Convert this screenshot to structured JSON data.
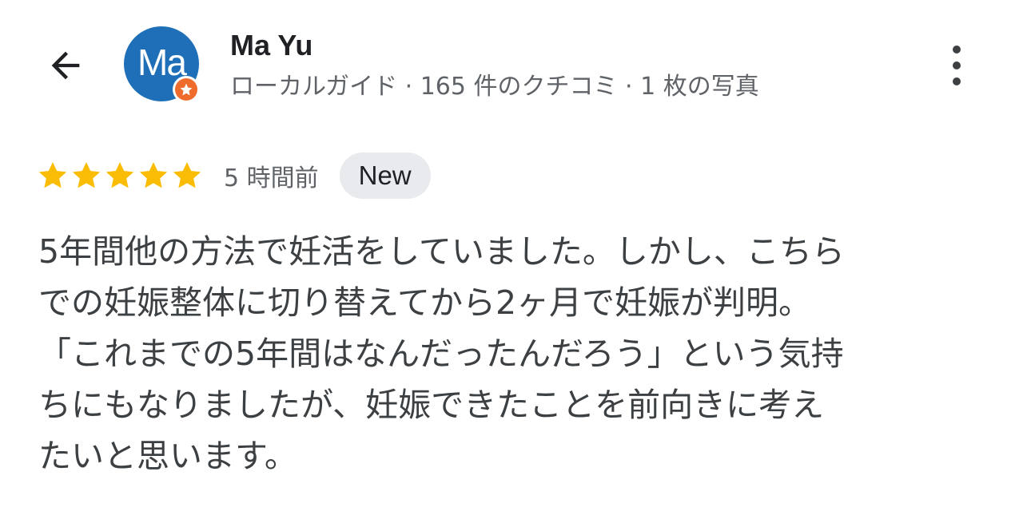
{
  "reviewer": {
    "name": "Ma Yu",
    "avatar_initials": "Ma",
    "avatar_color": "#1e6fb8",
    "badge_color": "#ef6c2d",
    "subtitle": "ローカルガイド · 165 件のクチコミ · 1 枚の写真"
  },
  "header": {
    "back_icon": "arrow-left-icon",
    "more_icon": "more-vert-icon"
  },
  "review": {
    "rating": 5,
    "max_rating": 5,
    "star_color": "#fbbc04",
    "time": "5 時間前",
    "new_label": "New",
    "text": "5年間他の方法で妊活をしていました。しかし、こちら\nでの妊娠整体に切り替えてから2ヶ月で妊娠が判明。\n「これまでの5年間はなんだったんだろう」という気持\nちにもなりましたが、妊娠できたことを前向きに考え\nたいと思います。"
  }
}
